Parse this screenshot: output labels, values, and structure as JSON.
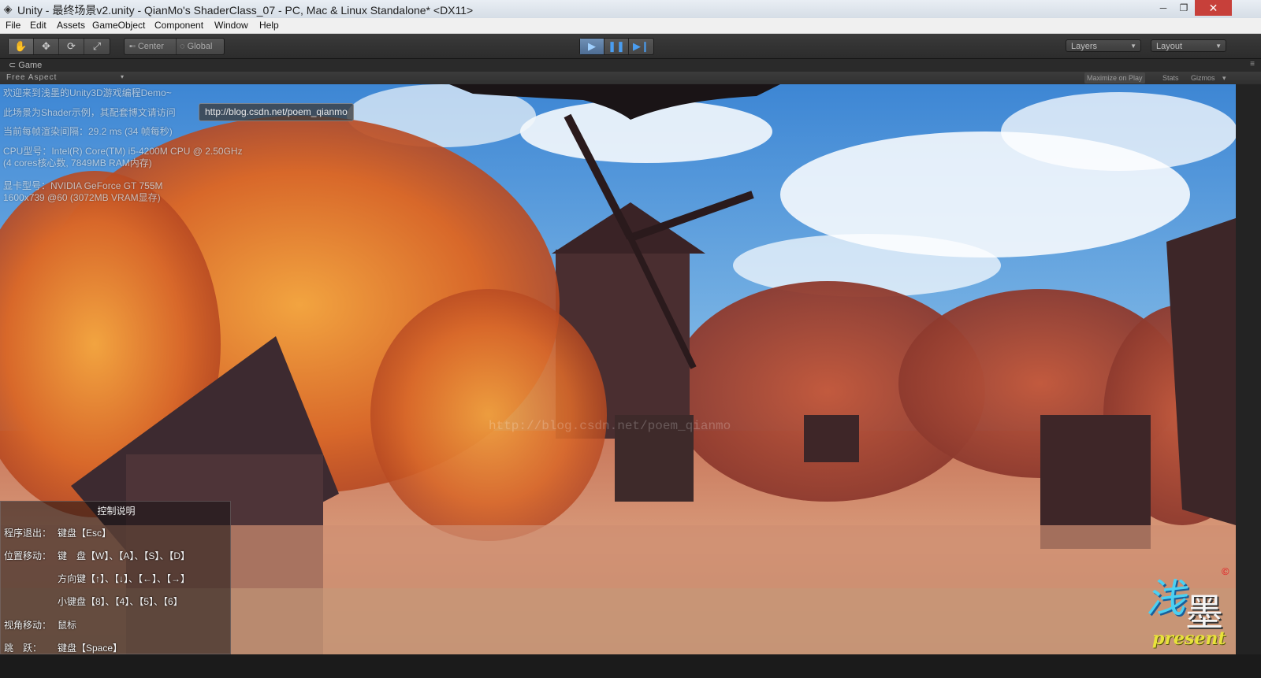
{
  "window": {
    "title": "Unity - 最终场景v2.unity - QianMo's ShaderClass_07 - PC, Mac & Linux Standalone* <DX11>",
    "minimize": "─",
    "maximize": "❐",
    "close": "✕"
  },
  "menu": [
    "File",
    "Edit",
    "Assets",
    "GameObject",
    "Component",
    "Window",
    "Help"
  ],
  "toolbar": {
    "pivot": "Center",
    "space": "Global",
    "layers": "Layers",
    "layout": "Layout"
  },
  "game_view": {
    "tab": "Game",
    "aspect": "Free Aspect",
    "maximize_on_play": "Maximize on Play",
    "stats": "Stats",
    "gizmos": "Gizmos"
  },
  "overlay": {
    "lines": [
      "欢迎来到浅墨的Unity3D游戏编程Demo~",
      "此场景为Shader示例，其配套博文请访问",
      "当前每帧渲染间隔：29.2 ms (34 帧每秒)",
      "CPU型号：Intel(R) Core(TM) i5-4200M CPU @ 2.50GHz",
      "(4 cores核心数, 7849MB RAM内存)",
      "显卡型号：NVIDIA GeForce GT 755M",
      "1600x739 @60 (3072MB VRAM显存)"
    ],
    "link": "http://blog.csdn.net/poem_qianmo",
    "watermark": "http://blog.csdn.net/poem_qianmo"
  },
  "controls": {
    "title": "控制说明",
    "rows": [
      {
        "label": "程序退出：",
        "value": "键盘【Esc】"
      },
      {
        "label": "位置移动：",
        "value": "键　盘【W】、【A】、【S】、【D】"
      },
      {
        "label": "",
        "value": "方向键【↑】、【↓】、【←】、【→】"
      },
      {
        "label": "",
        "value": "小键盘【8】、【4】、【5】、【6】"
      },
      {
        "label": "视角移动：",
        "value": "鼠标"
      },
      {
        "label": "跳　跃：",
        "value": "键盘【Space】"
      }
    ]
  },
  "logo": {
    "char1": "浅",
    "char2": "墨",
    "present": "present",
    "copyright": "©"
  }
}
